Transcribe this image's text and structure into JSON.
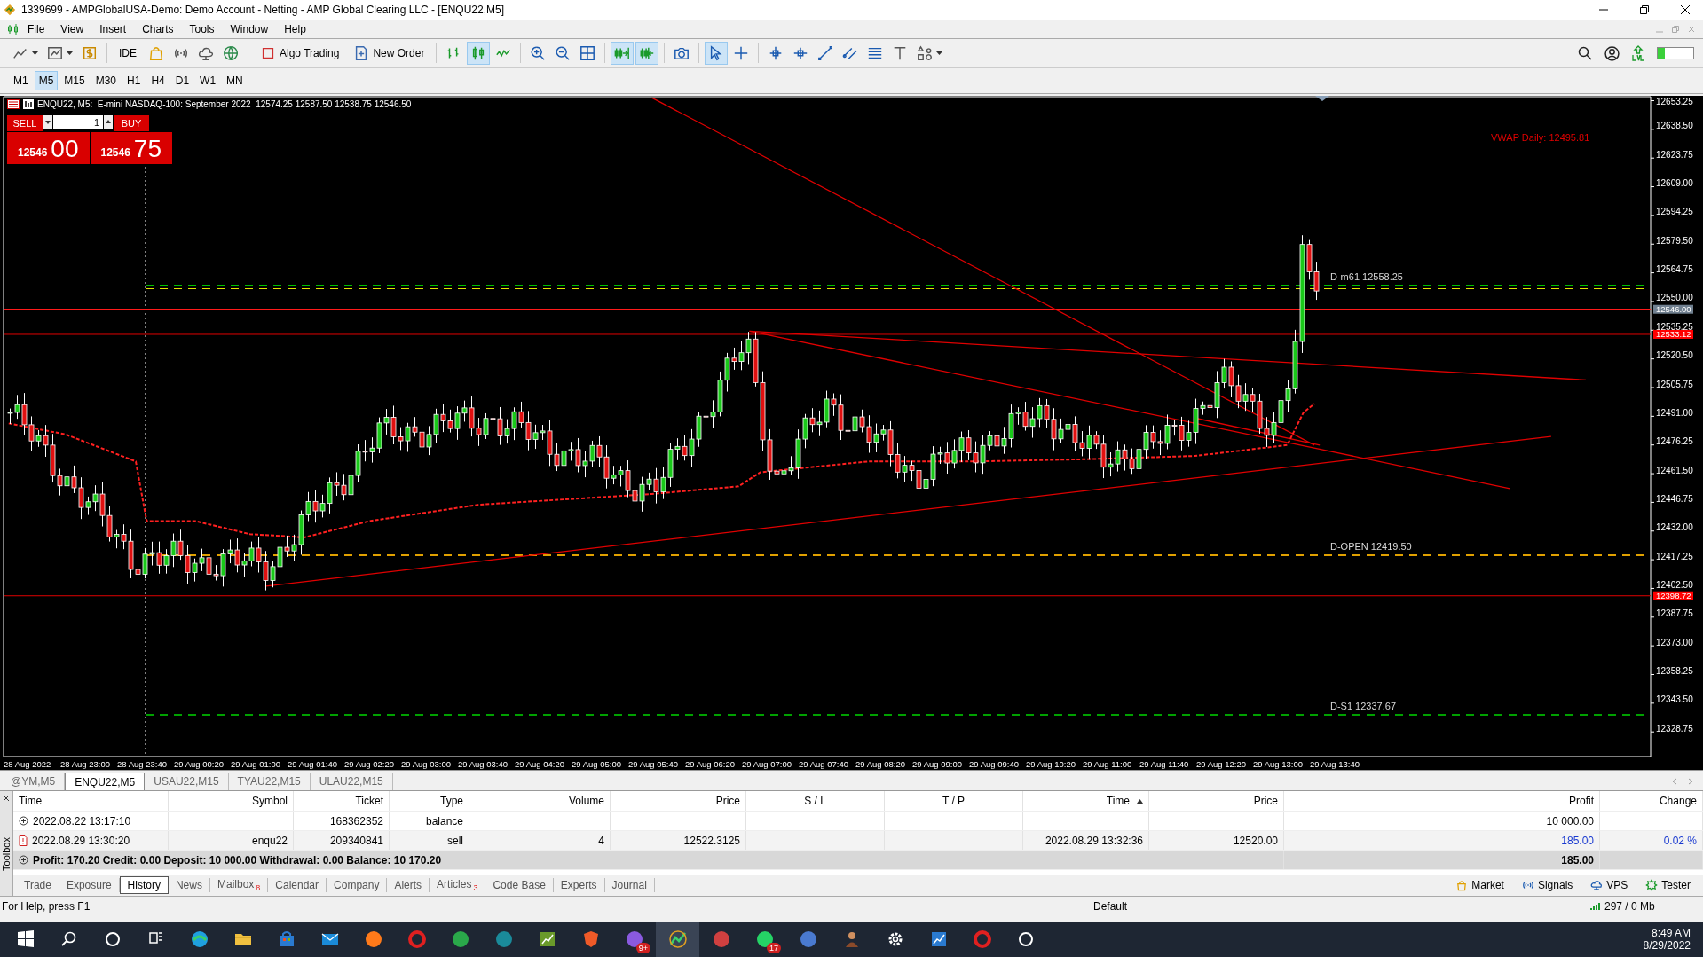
{
  "window": {
    "title": "1339699 - AMPGlobalUSA-Demo: Demo Account - Netting - AMP Global Clearing LLC - [ENQU22,M5]"
  },
  "menu": [
    "File",
    "View",
    "Insert",
    "Charts",
    "Tools",
    "Window",
    "Help"
  ],
  "toolbar": [
    {
      "kind": "line-chart",
      "selected": false
    },
    {
      "kind": "chart-window",
      "selected": false
    },
    {
      "kind": "dollar",
      "selected": false
    },
    {
      "kind": "ide",
      "label": "IDE",
      "selected": false
    },
    {
      "kind": "bag",
      "selected": false
    },
    {
      "kind": "signal",
      "selected": false
    },
    {
      "kind": "cloud",
      "selected": false
    },
    {
      "kind": "globe",
      "selected": false
    },
    {
      "kind": "algo",
      "label": "Algo Trading",
      "selected": false
    },
    {
      "kind": "order",
      "label": "New Order",
      "selected": false
    },
    {
      "kind": "bars",
      "selected": false
    },
    {
      "kind": "candles",
      "selected": true
    },
    {
      "kind": "line",
      "selected": false
    },
    {
      "kind": "zoom-in",
      "selected": false
    },
    {
      "kind": "zoom-out",
      "selected": false
    },
    {
      "kind": "grid",
      "selected": false
    },
    {
      "kind": "autoscroll",
      "selected": true
    },
    {
      "kind": "shift",
      "selected": true
    },
    {
      "kind": "camera",
      "selected": false
    },
    {
      "kind": "cursor",
      "selected": true
    },
    {
      "kind": "crosshair",
      "selected": false
    },
    {
      "kind": "vline",
      "selected": false
    },
    {
      "kind": "hline",
      "selected": false
    },
    {
      "kind": "trendline",
      "selected": false
    },
    {
      "kind": "channel",
      "selected": false
    },
    {
      "kind": "fibo",
      "selected": false
    },
    {
      "kind": "text",
      "selected": false
    },
    {
      "kind": "shapes",
      "selected": false
    }
  ],
  "timeframes": [
    {
      "label": "M1",
      "selected": false
    },
    {
      "label": "M5",
      "selected": true
    },
    {
      "label": "M15",
      "selected": false
    },
    {
      "label": "M30",
      "selected": false
    },
    {
      "label": "H1",
      "selected": false
    },
    {
      "label": "H4",
      "selected": false
    },
    {
      "label": "D1",
      "selected": false
    },
    {
      "label": "W1",
      "selected": false
    },
    {
      "label": "MN",
      "selected": false
    }
  ],
  "chart": {
    "header": "ENQU22, M5:  E-mini NASDAQ-100: September 2022  12574.25 12587.50 12538.75 12546.50",
    "trade_panel": {
      "sell": "SELL",
      "buy": "BUY",
      "volume": "1",
      "bid_small": "12546",
      "bid_big": "00",
      "ask_small": "12546",
      "ask_big": "75"
    },
    "vwap": "VWAP Daily: 12495.81",
    "levels": [
      {
        "label": "D-m61 12558.25",
        "color": "#00c000"
      },
      {
        "label": "D-OPEN 12419.50",
        "color": "#e0a000"
      },
      {
        "label": "D-S1 12337.67",
        "color": "#00a000"
      }
    ],
    "price_ticks": [
      "12653.25",
      "12638.50",
      "12623.75",
      "12609.00",
      "12594.25",
      "12579.50",
      "12564.75",
      "12550.00",
      "12535.25",
      "12520.50",
      "12505.75",
      "12491.00",
      "12476.25",
      "12461.50",
      "12446.75",
      "12432.00",
      "12417.25",
      "12402.50",
      "12387.75",
      "12373.00",
      "12358.25",
      "12343.50",
      "12328.75"
    ],
    "price_tags": [
      {
        "text": "12546.00",
        "color": "#708090"
      },
      {
        "text": "12533.12",
        "color": "#ff0000"
      },
      {
        "text": "12398.72",
        "color": "#ff0000"
      }
    ],
    "time_labels": [
      "28 Aug 2022",
      "28 Aug 23:00",
      "28 Aug 23:40",
      "29 Aug 00:20",
      "29 Aug 01:00",
      "29 Aug 01:40",
      "29 Aug 02:20",
      "29 Aug 03:00",
      "29 Aug 03:40",
      "29 Aug 04:20",
      "29 Aug 05:00",
      "29 Aug 05:40",
      "29 Aug 06:20",
      "29 Aug 07:00",
      "29 Aug 07:40",
      "29 Aug 08:20",
      "29 Aug 09:00",
      "29 Aug 09:40",
      "29 Aug 10:20",
      "29 Aug 11:00",
      "29 Aug 11:40",
      "29 Aug 12:20",
      "29 Aug 13:00",
      "29 Aug 13:40"
    ]
  },
  "chart_tabs": [
    {
      "label": "@YM,M5",
      "selected": false
    },
    {
      "label": "ENQU22,M5",
      "selected": true
    },
    {
      "label": "USAU22,M15",
      "selected": false
    },
    {
      "label": "TYAU22,M15",
      "selected": false
    },
    {
      "label": "ULAU22,M15",
      "selected": false
    }
  ],
  "history": {
    "columns": [
      "Time",
      "Symbol",
      "Ticket",
      "Type",
      "Volume",
      "Price",
      "S / L",
      "T / P",
      "Time",
      "Price",
      "Profit",
      "Change"
    ],
    "rows": [
      {
        "kind": "balance",
        "cells": [
          "2022.08.22 13:17:10",
          "",
          "168362352",
          "balance",
          "",
          "",
          "",
          "",
          "",
          "",
          "10 000.00",
          ""
        ]
      },
      {
        "kind": "sell",
        "cells": [
          "2022.08.29 13:30:20",
          "enqu22",
          "209340841",
          "sell",
          "4",
          "12522.3125",
          "",
          "",
          "2022.08.29 13:32:36",
          "12520.00",
          "185.00",
          "0.02 %"
        ]
      }
    ],
    "summary": "Profit: 170.20 Credit: 0.00 Deposit: 10 000.00 Withdrawal: 0.00 Balance: 10 170.20",
    "summary_profit": "185.00"
  },
  "toolbox": {
    "title": "Toolbox"
  },
  "bottom_tabs": [
    {
      "label": "Trade",
      "selected": false
    },
    {
      "label": "Exposure",
      "selected": false
    },
    {
      "label": "History",
      "selected": true
    },
    {
      "label": "News",
      "selected": false
    },
    {
      "label": "Mailbox",
      "badge": "8",
      "selected": false
    },
    {
      "label": "Calendar",
      "selected": false
    },
    {
      "label": "Company",
      "selected": false
    },
    {
      "label": "Alerts",
      "selected": false
    },
    {
      "label": "Articles",
      "badge": "3",
      "selected": false
    },
    {
      "label": "Code Base",
      "selected": false
    },
    {
      "label": "Experts",
      "selected": false
    },
    {
      "label": "Journal",
      "selected": false
    }
  ],
  "services": [
    {
      "kind": "market",
      "label": "Market"
    },
    {
      "kind": "signals",
      "label": "Signals"
    },
    {
      "kind": "vps",
      "label": "VPS"
    },
    {
      "kind": "tester",
      "label": "Tester"
    }
  ],
  "status_bar": {
    "help": "For Help, press F1",
    "profile": "Default",
    "traffic": "297 / 0 Mb"
  },
  "taskbar": {
    "apps": [
      {
        "kind": "start",
        "selected": false
      },
      {
        "kind": "search",
        "selected": false
      },
      {
        "kind": "ring",
        "selected": false
      },
      {
        "kind": "taskview",
        "selected": false
      },
      {
        "kind": "wave",
        "color": "#1fa0e0",
        "selected": false
      },
      {
        "kind": "folder",
        "selected": false
      },
      {
        "kind": "bag",
        "selected": false
      },
      {
        "kind": "mail",
        "selected": false
      },
      {
        "kind": "ball",
        "color": "#ff7a1a",
        "selected": false
      },
      {
        "kind": "ring-red",
        "selected": false
      },
      {
        "kind": "ball",
        "color": "#2aa84a",
        "selected": false
      },
      {
        "kind": "ball",
        "color": "#1a8a9a",
        "selected": false
      },
      {
        "kind": "square",
        "color": "#6a9a2a",
        "selected": false
      },
      {
        "kind": "shield",
        "selected": false
      },
      {
        "kind": "ball",
        "color": "#8a5ae0",
        "badge": "9+",
        "selected": false
      },
      {
        "kind": "chart",
        "selected": true
      },
      {
        "kind": "ball",
        "color": "#d04040",
        "selected": false
      },
      {
        "kind": "ball",
        "color": "#25d366",
        "badge": "17",
        "selected": false
      },
      {
        "kind": "ball",
        "color": "#4a7ad0",
        "selected": false
      },
      {
        "kind": "figure",
        "selected": false
      },
      {
        "kind": "gear",
        "selected": false
      },
      {
        "kind": "square",
        "color": "#2a7ad0",
        "selected": false
      },
      {
        "kind": "ring-red",
        "selected": false
      },
      {
        "kind": "ring",
        "selected": false
      }
    ],
    "time": "8:49 AM",
    "date": "8/29/2022"
  }
}
